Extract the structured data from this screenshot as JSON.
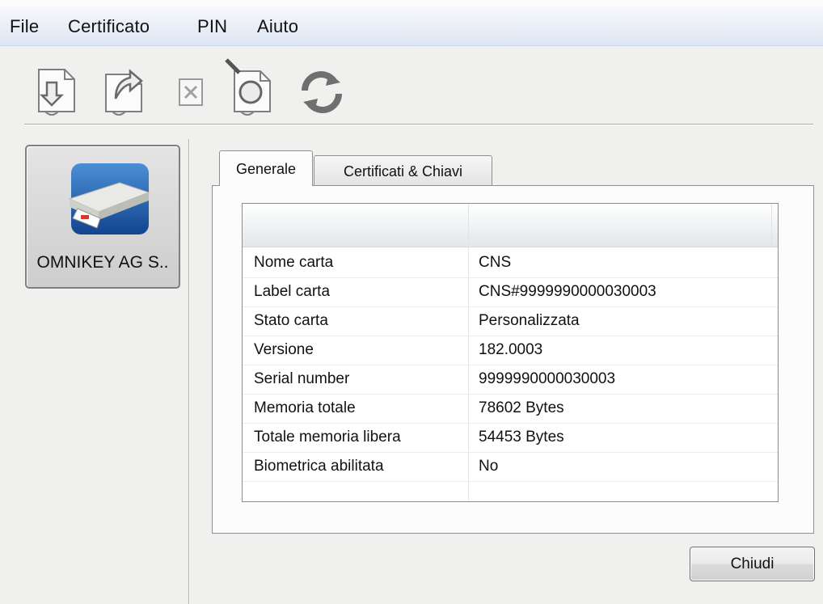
{
  "menu": [
    "File",
    "Certificato",
    "PIN",
    "Aiuto"
  ],
  "toolbar": [
    {
      "icon": "import-certificate-icon"
    },
    {
      "icon": "export-certificate-icon"
    },
    {
      "icon": "delete-icon"
    },
    {
      "icon": "view-certificate-icon"
    },
    {
      "icon": "refresh-icon"
    }
  ],
  "device": {
    "label": "OMNIKEY AG S..",
    "icon": "smart-card-reader-icon"
  },
  "tabs": [
    "Generale",
    "Certificati & Chiavi"
  ],
  "table": {
    "headers": [
      "",
      ""
    ],
    "rows": [
      {
        "name": "Nome carta",
        "value": "CNS"
      },
      {
        "name": "Label carta",
        "value": "CNS#9999990000030003"
      },
      {
        "name": "Stato carta",
        "value": "Personalizzata"
      },
      {
        "name": "Versione",
        "value": "182.0003"
      },
      {
        "name": "Serial number",
        "value": "9999990000030003"
      },
      {
        "name": "Memoria totale",
        "value": "78602 Bytes"
      },
      {
        "name": "Totale memoria libera",
        "value": "54453 Bytes"
      },
      {
        "name": "Biometrica abilitata",
        "value": "No"
      }
    ]
  },
  "close_button": "Chiudi",
  "colors": {
    "menubar": "#dde6f3",
    "background": "#f0f0ee",
    "device_icon_bg": "#1d5fb0"
  }
}
